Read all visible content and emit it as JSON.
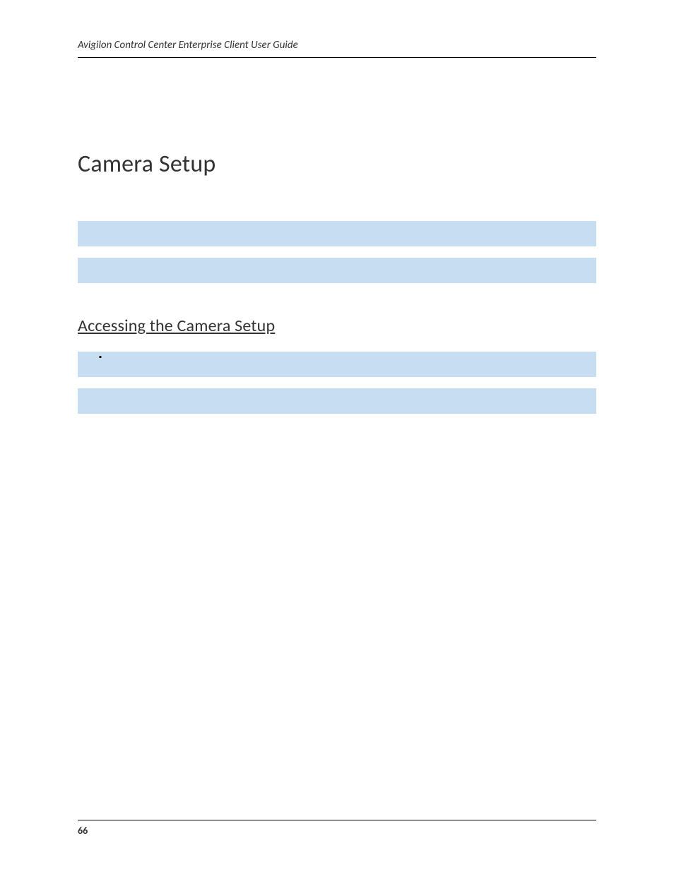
{
  "header": {
    "title": "Avigilon Control Center Enterprise Client User Guide"
  },
  "page": {
    "title": "Camera Setup",
    "intro": "",
    "infobox1": "",
    "infobox2": "",
    "section": {
      "title": "Accessing the Camera Setup",
      "intro": "",
      "bullets": [
        "",
        ""
      ],
      "subbox1": "",
      "subbox2": ""
    }
  },
  "footer": {
    "pageNumber": "66"
  }
}
